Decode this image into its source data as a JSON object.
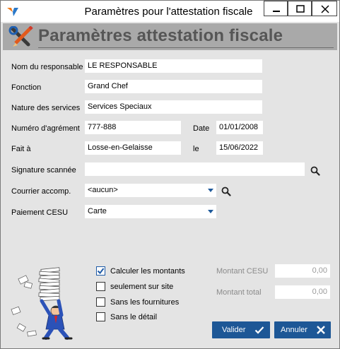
{
  "window": {
    "title": "Paramètres pour l'attestation fiscale"
  },
  "header": {
    "title": "Paramètres attestation fiscale"
  },
  "form": {
    "responsable": {
      "label": "Nom du responsable",
      "value": "LE RESPONSABLE"
    },
    "fonction": {
      "label": "Fonction",
      "value": "Grand Chef"
    },
    "nature": {
      "label": "Nature des services",
      "value": "Services Speciaux"
    },
    "agrement": {
      "label": "Numéro d'agrément",
      "value": "777-888"
    },
    "date": {
      "label": "Date",
      "value": "01/01/2008"
    },
    "fait_a": {
      "label": "Fait à",
      "value": "Losse-en-Gelaisse"
    },
    "le": {
      "label": "le",
      "value": "15/06/2022"
    },
    "signature": {
      "label": "Signature scannée",
      "value": ""
    },
    "courrier": {
      "label": "Courrier accomp.",
      "value": "<aucun>"
    },
    "paiement": {
      "label": "Paiement CESU",
      "value": "Carte"
    }
  },
  "options": {
    "calculer": {
      "label": "Calculer les montants",
      "checked": true
    },
    "site": {
      "label": "seulement sur site",
      "checked": false
    },
    "fournitures": {
      "label": "Sans les fournitures",
      "checked": false
    },
    "detail": {
      "label": "Sans le détail",
      "checked": false
    }
  },
  "totals": {
    "cesu": {
      "label": "Montant CESU",
      "value": "0,00"
    },
    "total": {
      "label": "Montant total",
      "value": "0,00"
    }
  },
  "buttons": {
    "valider": "Valider",
    "annuler": "Annuler"
  },
  "colors": {
    "accent": "#1d5796",
    "header_band": "#a9a9a9",
    "background": "#e4e4e4"
  }
}
